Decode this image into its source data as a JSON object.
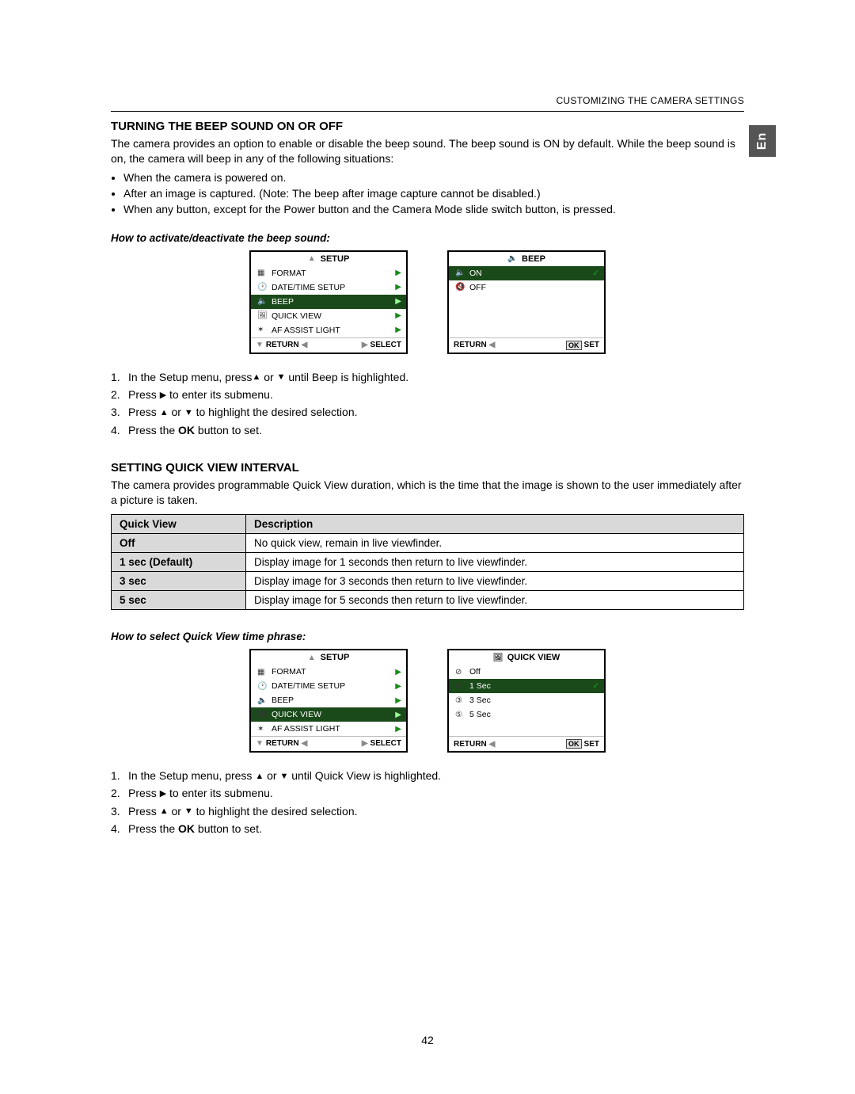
{
  "header": {
    "breadcrumb": "CUSTOMIZING THE CAMERA SETTINGS"
  },
  "lang_tab": "En",
  "section_beep": {
    "title": "TURNING THE BEEP SOUND ON OR OFF",
    "intro": "The camera provides an option to enable or disable the beep sound. The beep sound is ON by default. While the beep sound is on, the camera will beep in any of the following situations:",
    "bullets": [
      "When the camera is powered on.",
      "After an image is captured. (Note: The beep after image capture cannot be disabled.)",
      "When any button, except for the Power button and the Camera Mode slide switch button, is pressed."
    ],
    "howto_heading": "How to activate/deactivate the beep sound:",
    "steps_parts": {
      "s1a": "In the Setup menu, press",
      "s1b": " or ",
      "s1c": " until Beep is highlighted.",
      "s2a": "Press ",
      "s2b": " to enter its submenu.",
      "s3a": "Press ",
      "s3b": " or ",
      "s3c": " to highlight the desired selection.",
      "s4a": "Press the ",
      "s4b": "OK",
      "s4c": " button to set."
    }
  },
  "screen_setup_beep": {
    "title": "SETUP",
    "items": [
      {
        "icon": "▦",
        "label": "FORMAT"
      },
      {
        "icon": "🕑",
        "label": "DATE/TIME SETUP"
      },
      {
        "icon": "🔈",
        "label": "BEEP",
        "hi": true
      },
      {
        "icon": "🖼",
        "label": "QUICK VIEW"
      },
      {
        "icon": "✶",
        "label": "AF ASSIST LIGHT"
      }
    ],
    "footer": {
      "return": "RETURN",
      "select": "SELECT"
    }
  },
  "screen_beep_options": {
    "title": "BEEP",
    "items": [
      {
        "icon": "🔈",
        "label": "ON",
        "hi": true,
        "check": true
      },
      {
        "icon": "🔇",
        "label": "OFF"
      }
    ],
    "footer": {
      "return": "RETURN",
      "set": "SET"
    }
  },
  "section_qv": {
    "title": "SETTING QUICK VIEW INTERVAL",
    "intro": "The camera provides programmable Quick View duration, which is the time that the image is shown to the user immediately after a picture is taken.",
    "table": {
      "headers": [
        "Quick View",
        "Description"
      ],
      "rows": [
        [
          "Off",
          "No quick view, remain in live viewfinder."
        ],
        [
          "1 sec (Default)",
          "Display image for 1 seconds then return to live viewfinder."
        ],
        [
          "3 sec",
          "Display image for 3 seconds then return to live viewfinder."
        ],
        [
          "5 sec",
          "Display image for 5 seconds then return to live viewfinder."
        ]
      ]
    },
    "howto_heading": "How to select Quick View time phrase:",
    "steps_parts": {
      "s1a": "In the Setup menu, press ",
      "s1b": " or ",
      "s1c": " until Quick View is highlighted.",
      "s2a": "Press ",
      "s2b": " to enter its submenu.",
      "s3a": "Press ",
      "s3b": " or ",
      "s3c": " to highlight the desired selection.",
      "s4a": "Press the ",
      "s4b": "OK",
      "s4c": " button to set."
    }
  },
  "screen_setup_qv": {
    "title": "SETUP",
    "items": [
      {
        "icon": "▦",
        "label": "FORMAT"
      },
      {
        "icon": "🕑",
        "label": "DATE/TIME SETUP"
      },
      {
        "icon": "🔈",
        "label": "BEEP"
      },
      {
        "icon": "🖼",
        "label": "QUICK VIEW",
        "hi": true
      },
      {
        "icon": "✶",
        "label": "AF ASSIST LIGHT"
      }
    ],
    "footer": {
      "return": "RETURN",
      "select": "SELECT"
    }
  },
  "screen_qv_options": {
    "title": "QUICK VIEW",
    "items": [
      {
        "icon": "⊘",
        "label": "Off"
      },
      {
        "icon": "①",
        "label": "1 Sec",
        "hi": true,
        "check": true
      },
      {
        "icon": "③",
        "label": "3 Sec"
      },
      {
        "icon": "⑤",
        "label": "5 Sec"
      }
    ],
    "footer": {
      "return": "RETURN",
      "set": "SET"
    }
  },
  "page_number": "42"
}
